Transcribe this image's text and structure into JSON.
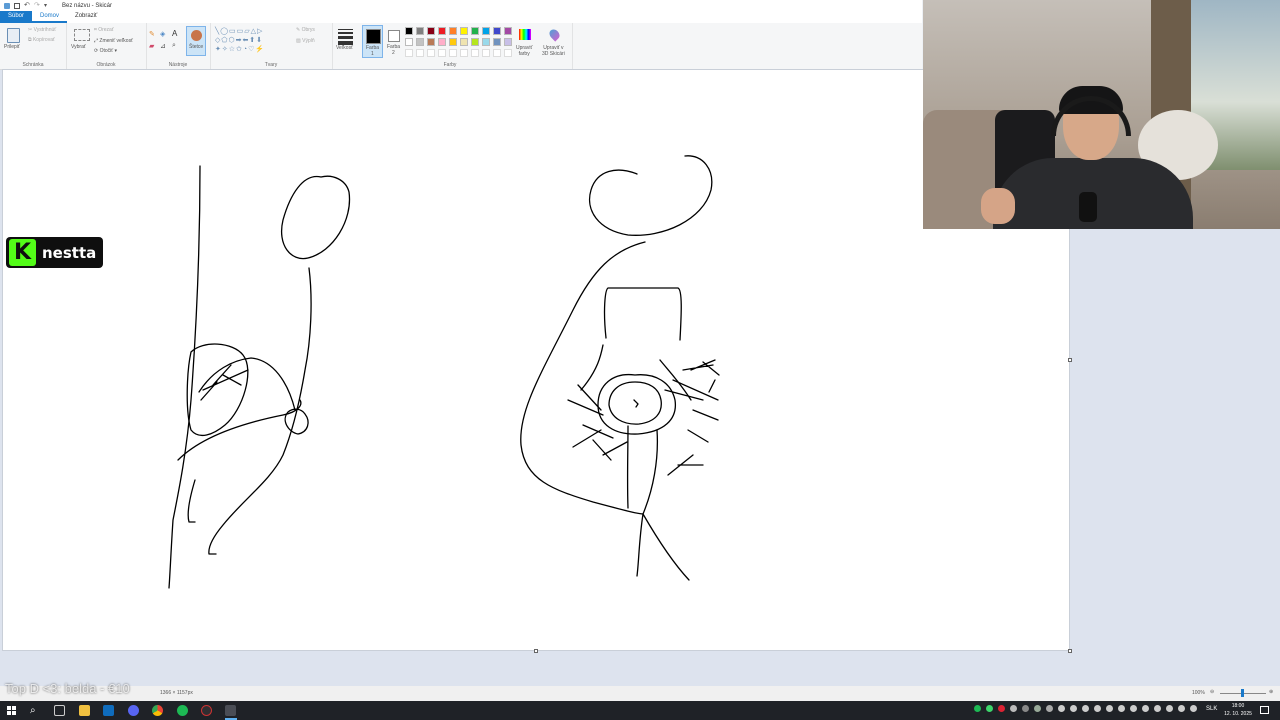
{
  "window": {
    "title": "Bez názvu - Skicár"
  },
  "menu": {
    "file": "Súbor",
    "home": "Domov",
    "view": "Zobraziť"
  },
  "ribbon": {
    "clipboard": {
      "label": "Schránka",
      "paste": "Prilepiť",
      "cut": "Vystrihnúť",
      "copy": "Kopírovať"
    },
    "image": {
      "label": "Obrázok",
      "select": "Vybrať",
      "crop": "Orezať",
      "resize": "Zmeniť veľkosť",
      "rotate": "Otočiť"
    },
    "tools": {
      "label": "Nástroje",
      "brushes": "Štetce"
    },
    "shapes": {
      "label": "Tvary",
      "outline": "Obrys",
      "fill": "Výplň"
    },
    "size": {
      "label": "Veľkosť"
    },
    "colors": {
      "label": "Farby",
      "color1": "Farba",
      "color1_num": "1",
      "color2": "Farba",
      "color2_num": "2",
      "edit_colors_1": "Upraviť",
      "edit_colors_2": "farby",
      "edit_3d_1": "Upraviť v",
      "edit_3d_2": "3D Skicári",
      "palette_row1": [
        "#000000",
        "#7f7f7f",
        "#880015",
        "#ed1c24",
        "#ff7f27",
        "#fff200",
        "#22b14c",
        "#00a2e8",
        "#3f48cc",
        "#a349a4"
      ],
      "palette_row2": [
        "#ffffff",
        "#c3c3c3",
        "#b97a57",
        "#ffaec9",
        "#ffc90e",
        "#efe4b0",
        "#b5e61d",
        "#99d9ea",
        "#7092be",
        "#c8bfe7"
      ],
      "primary": "#000000",
      "secondary": "#ffffff"
    }
  },
  "status": {
    "canvas_size": "1366 × 1157px",
    "zoom": "100%"
  },
  "overlay": {
    "text": "Top D <3: belda - €10",
    "brand": "nestta"
  },
  "taskbar": {
    "lang": "SLK",
    "time": "18:00",
    "date": "12. 10. 2025"
  }
}
